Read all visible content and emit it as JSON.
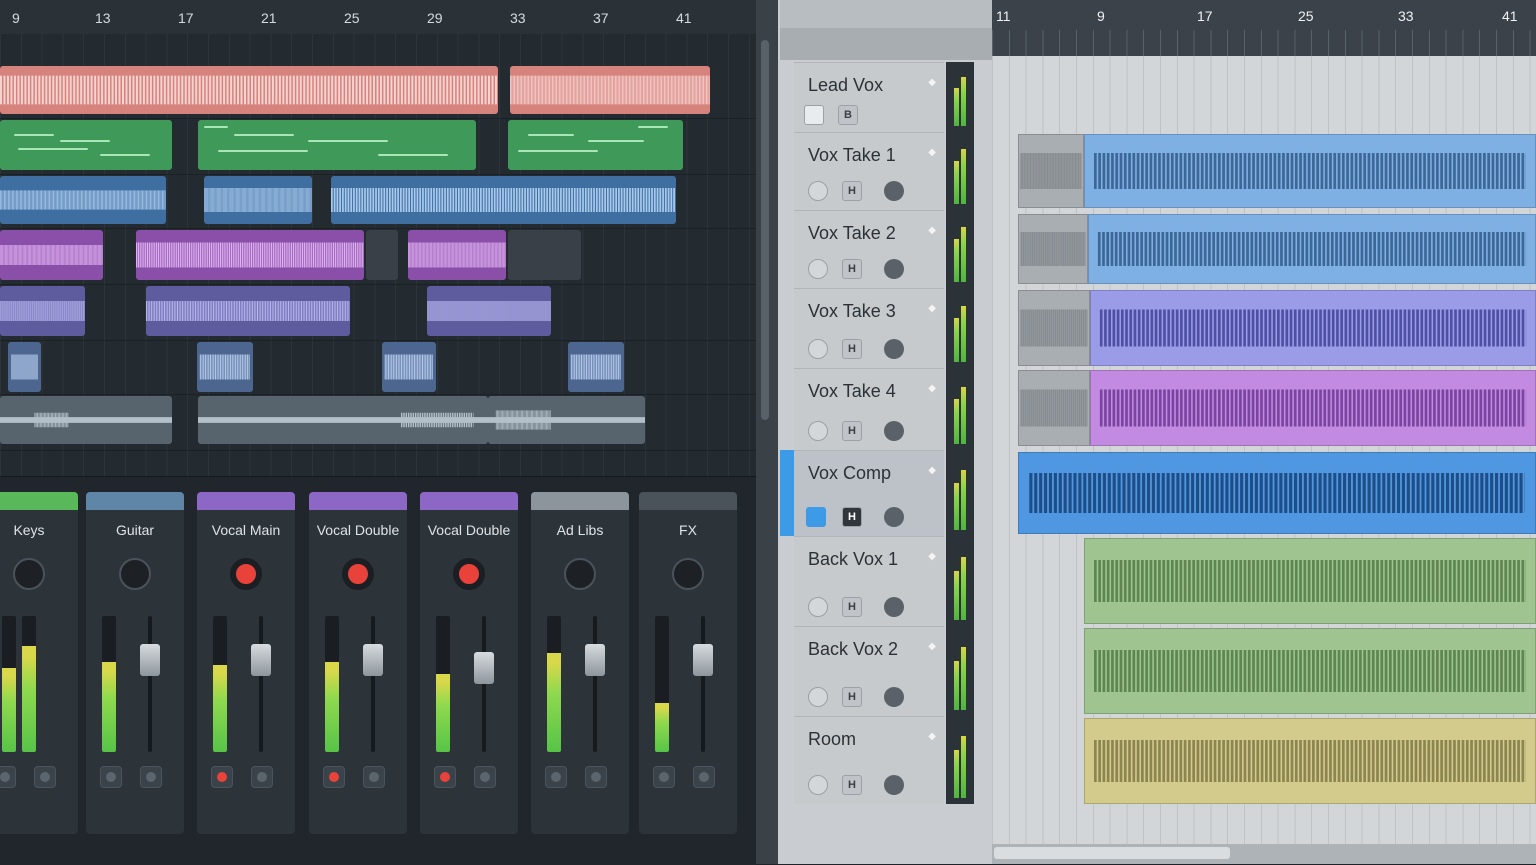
{
  "left_ruler": {
    "marks": [
      "9",
      "13",
      "17",
      "21",
      "25",
      "29",
      "33",
      "37",
      "41"
    ]
  },
  "mixer": {
    "channels": [
      {
        "name": "Keys",
        "color": "#58b85a",
        "knob": "dark",
        "meters": [
          0.62,
          0.78
        ],
        "rec": false
      },
      {
        "name": "Guitar",
        "color": "#5f86a6",
        "knob": "dark",
        "meters": [
          0.66
        ],
        "fader": 0.68,
        "rec": false
      },
      {
        "name": "Vocal Main",
        "color": "#8c67c6",
        "knob": "red",
        "meters": [
          0.64
        ],
        "fader": 0.68,
        "rec": true
      },
      {
        "name": "Vocal Double",
        "color": "#8c67c6",
        "knob": "red",
        "meters": [
          0.66
        ],
        "fader": 0.68,
        "rec": true
      },
      {
        "name": "Vocal Double",
        "color": "#8c67c6",
        "knob": "red",
        "meters": [
          0.57
        ],
        "fader": 0.62,
        "rec": true
      },
      {
        "name": "Ad Libs",
        "color": "#8d959c",
        "knob": "dark",
        "meters": [
          0.73
        ],
        "fader": 0.68,
        "rec": false
      },
      {
        "name": "FX",
        "color": "#4a525a",
        "knob": "dark",
        "meters": [
          0.36
        ],
        "fader": 0.68,
        "rec": false
      }
    ]
  },
  "right_ruler": {
    "marks": [
      "11",
      "9",
      "17",
      "25",
      "33",
      "41"
    ]
  },
  "tracks": [
    {
      "name": "Lead Vox",
      "btn": "B",
      "selected": false
    },
    {
      "name": "Vox Take 1",
      "btn": "H",
      "selected": false
    },
    {
      "name": "Vox Take 2",
      "btn": "H",
      "selected": false
    },
    {
      "name": "Vox Take 3",
      "btn": "H",
      "selected": false
    },
    {
      "name": "Vox Take 4",
      "btn": "H",
      "selected": false
    },
    {
      "name": "Vox Comp",
      "btn": "H",
      "selected": true
    },
    {
      "name": "Back Vox 1",
      "btn": "H",
      "selected": false
    },
    {
      "name": "Back Vox 2",
      "btn": "H",
      "selected": false
    },
    {
      "name": "Room",
      "btn": "H",
      "selected": false
    }
  ],
  "colors": {
    "vocal_red": "#d97b78",
    "midi_green": "#3f9a5a",
    "blue": "#5d8fc7",
    "purple": "#a45fc2",
    "lavender": "#7c7ec8",
    "take_blue": "#7fb0e4",
    "take_violet": "#9a9ce8",
    "take_purple": "#c28ae0",
    "comp_blue": "#4f97e0",
    "bv_green": "#9fc48f",
    "room_yellow": "#d3cb8c"
  }
}
